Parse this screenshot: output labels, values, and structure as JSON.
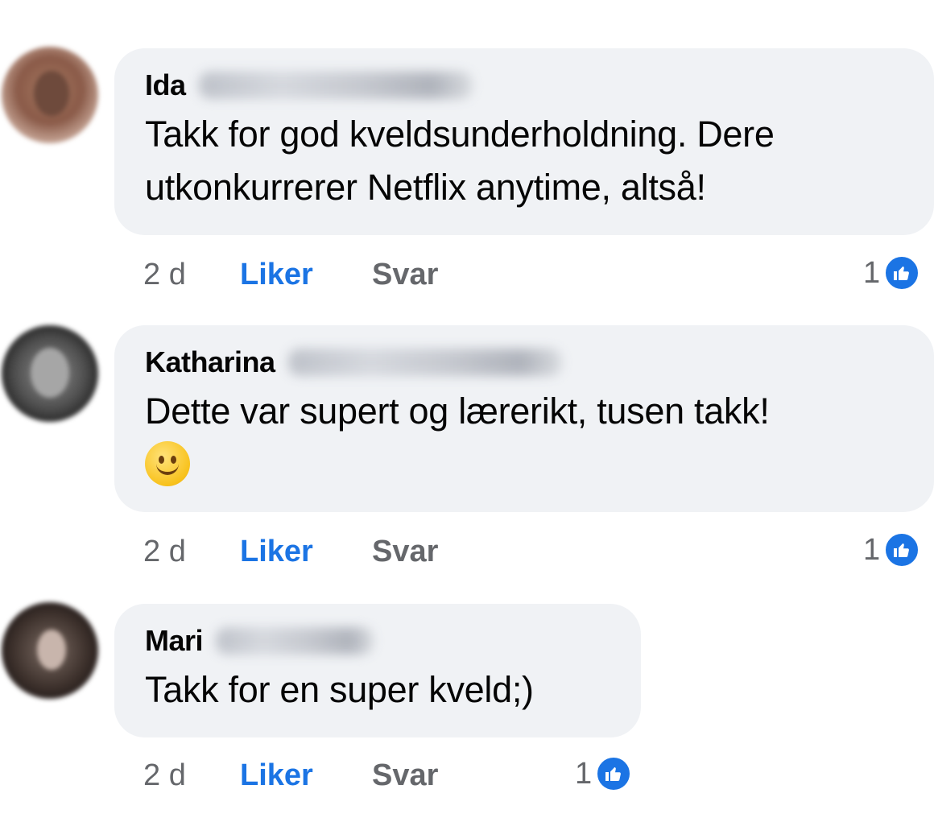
{
  "comments": [
    {
      "author": "Ida",
      "text": [
        "Takk for god kveldsunderholdning. Dere",
        "utkonkurrerer Netflix anytime, altså!"
      ],
      "time": "2 d",
      "like_label": "Liker",
      "reply_label": "Svar",
      "reaction_count": "1",
      "reaction_icon": "thumbs-up-icon"
    },
    {
      "author": "Katharina",
      "text": [
        "Dette var supert og lærerikt, tusen takk!"
      ],
      "emoji": "slightly-smiling-face",
      "time": "2 d",
      "like_label": "Liker",
      "reply_label": "Svar",
      "reaction_count": "1",
      "reaction_icon": "thumbs-up-icon"
    },
    {
      "author": "Mari",
      "text": [
        "Takk for en super kveld;)"
      ],
      "time": "2 d",
      "like_label": "Liker",
      "reply_label": "Svar",
      "reaction_count": "1",
      "reaction_icon": "thumbs-up-icon"
    }
  ],
  "colors": {
    "bubble": "#f0f2f5",
    "link_blue": "#1b74e4",
    "secondary_text": "#65676b"
  }
}
